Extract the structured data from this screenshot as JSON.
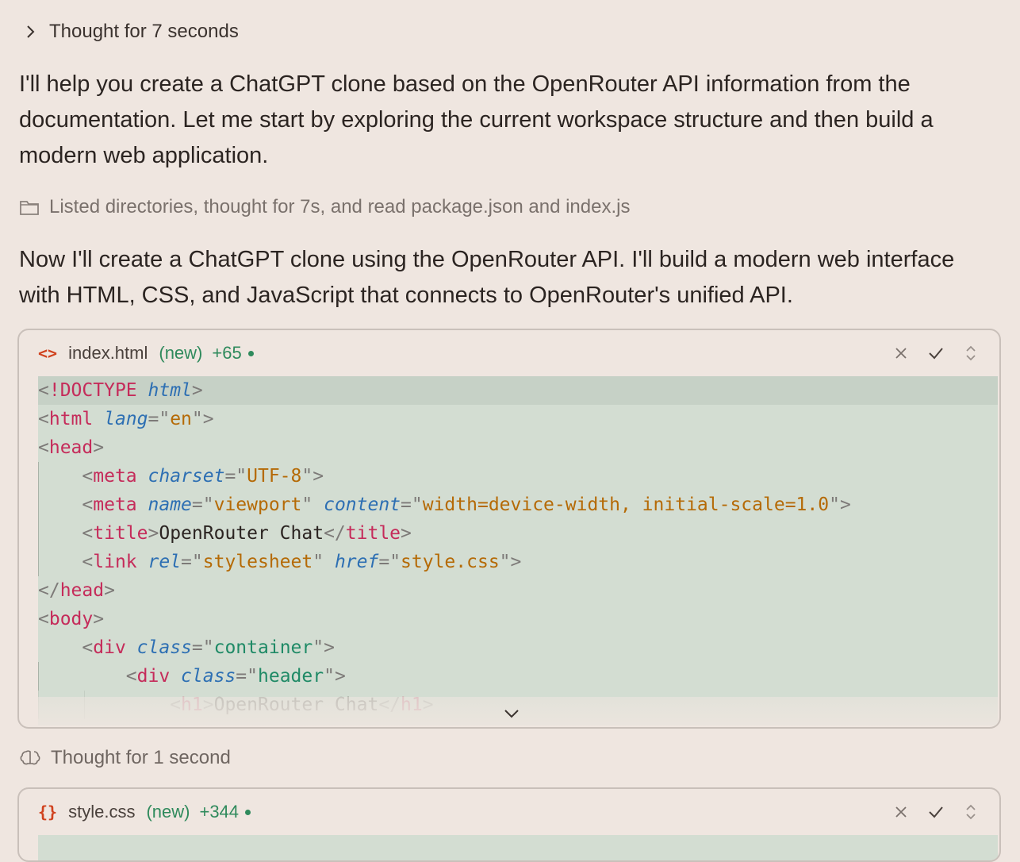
{
  "thought_top": {
    "label": "Thought for 7 seconds",
    "icon": "chevron-right-icon"
  },
  "message1": "I'll help you create a ChatGPT clone based on the OpenRouter API information from the documentation. Let me start by exploring the current workspace structure and then build a modern web application.",
  "activity": {
    "label": "Listed directories, thought for 7s, and read package.json and index.js",
    "icon": "folder-icon"
  },
  "message2": "Now I'll create a ChatGPT clone using the OpenRouter API. I'll build a modern web interface with HTML, CSS, and JavaScript that connects to OpenRouter's unified API.",
  "card1": {
    "icon_text": "<>",
    "filename": "index.html",
    "status": "(new)",
    "added": "+65",
    "actions": [
      "close-icon",
      "check-icon",
      "expand-collapse-icon"
    ],
    "code_lines": [
      [
        {
          "t": "br",
          "v": "<"
        },
        {
          "t": "tag",
          "v": "!DOCTYPE"
        },
        {
          "t": "txt",
          "v": " "
        },
        {
          "t": "attr",
          "v": "html"
        },
        {
          "t": "br",
          "v": ">"
        }
      ],
      [
        {
          "t": "br",
          "v": "<"
        },
        {
          "t": "tag",
          "v": "html"
        },
        {
          "t": "txt",
          "v": " "
        },
        {
          "t": "attr",
          "v": "lang"
        },
        {
          "t": "br",
          "v": "=\""
        },
        {
          "t": "str",
          "v": "en"
        },
        {
          "t": "br",
          "v": "\">"
        }
      ],
      [
        {
          "t": "br",
          "v": "<"
        },
        {
          "t": "tag",
          "v": "head"
        },
        {
          "t": "br",
          "v": ">"
        }
      ],
      [
        {
          "t": "txt",
          "v": "    "
        },
        {
          "t": "br",
          "v": "<"
        },
        {
          "t": "tag",
          "v": "meta"
        },
        {
          "t": "txt",
          "v": " "
        },
        {
          "t": "attr",
          "v": "charset"
        },
        {
          "t": "br",
          "v": "=\""
        },
        {
          "t": "str",
          "v": "UTF-8"
        },
        {
          "t": "br",
          "v": "\">"
        }
      ],
      [
        {
          "t": "txt",
          "v": "    "
        },
        {
          "t": "br",
          "v": "<"
        },
        {
          "t": "tag",
          "v": "meta"
        },
        {
          "t": "txt",
          "v": " "
        },
        {
          "t": "attr",
          "v": "name"
        },
        {
          "t": "br",
          "v": "=\""
        },
        {
          "t": "str",
          "v": "viewport"
        },
        {
          "t": "br",
          "v": "\""
        },
        {
          "t": "txt",
          "v": " "
        },
        {
          "t": "attr",
          "v": "content"
        },
        {
          "t": "br",
          "v": "=\""
        },
        {
          "t": "str",
          "v": "width=device-width, initial-scale=1.0"
        },
        {
          "t": "br",
          "v": "\">"
        }
      ],
      [
        {
          "t": "txt",
          "v": "    "
        },
        {
          "t": "br",
          "v": "<"
        },
        {
          "t": "tag",
          "v": "title"
        },
        {
          "t": "br",
          "v": ">"
        },
        {
          "t": "txt",
          "v": "OpenRouter Chat"
        },
        {
          "t": "br",
          "v": "</"
        },
        {
          "t": "tag",
          "v": "title"
        },
        {
          "t": "br",
          "v": ">"
        }
      ],
      [
        {
          "t": "txt",
          "v": "    "
        },
        {
          "t": "br",
          "v": "<"
        },
        {
          "t": "tag",
          "v": "link"
        },
        {
          "t": "txt",
          "v": " "
        },
        {
          "t": "attr",
          "v": "rel"
        },
        {
          "t": "br",
          "v": "=\""
        },
        {
          "t": "str",
          "v": "stylesheet"
        },
        {
          "t": "br",
          "v": "\""
        },
        {
          "t": "txt",
          "v": " "
        },
        {
          "t": "attr",
          "v": "href"
        },
        {
          "t": "br",
          "v": "=\""
        },
        {
          "t": "str",
          "v": "style.css"
        },
        {
          "t": "br",
          "v": "\">"
        }
      ],
      [
        {
          "t": "br",
          "v": "</"
        },
        {
          "t": "tag",
          "v": "head"
        },
        {
          "t": "br",
          "v": ">"
        }
      ],
      [
        {
          "t": "br",
          "v": "<"
        },
        {
          "t": "tag",
          "v": "body"
        },
        {
          "t": "br",
          "v": ">"
        }
      ],
      [
        {
          "t": "txt",
          "v": "    "
        },
        {
          "t": "br",
          "v": "<"
        },
        {
          "t": "tag",
          "v": "div"
        },
        {
          "t": "txt",
          "v": " "
        },
        {
          "t": "attr",
          "v": "class"
        },
        {
          "t": "br",
          "v": "=\""
        },
        {
          "t": "strg",
          "v": "container"
        },
        {
          "t": "br",
          "v": "\">"
        }
      ],
      [
        {
          "t": "txt",
          "v": "        "
        },
        {
          "t": "br",
          "v": "<"
        },
        {
          "t": "tag",
          "v": "div"
        },
        {
          "t": "txt",
          "v": " "
        },
        {
          "t": "attr",
          "v": "class"
        },
        {
          "t": "br",
          "v": "=\""
        },
        {
          "t": "strg",
          "v": "header"
        },
        {
          "t": "br",
          "v": "\">"
        }
      ],
      [
        {
          "t": "txt",
          "v": "            "
        },
        {
          "t": "br",
          "v": "<"
        },
        {
          "t": "tag",
          "v": "h1"
        },
        {
          "t": "br",
          "v": ">"
        },
        {
          "t": "txt",
          "v": "OpenRouter Chat"
        },
        {
          "t": "br",
          "v": "</"
        },
        {
          "t": "tag",
          "v": "h1"
        },
        {
          "t": "br",
          "v": ">"
        }
      ]
    ]
  },
  "thought2": {
    "label": "Thought for 1 second",
    "icon": "brain-icon"
  },
  "card2": {
    "icon_text": "{}",
    "filename": "style.css",
    "status": "(new)",
    "added": "+344",
    "actions": [
      "close-icon",
      "check-icon",
      "expand-collapse-icon"
    ]
  },
  "colors": {
    "background": "#efe6e0",
    "code_background": "#d3ddd2",
    "added_green": "#2f8a5c",
    "file_icon": "#d0421e",
    "tag": "#c52b5a",
    "attribute": "#2d6fb3",
    "string": "#b56a06"
  }
}
